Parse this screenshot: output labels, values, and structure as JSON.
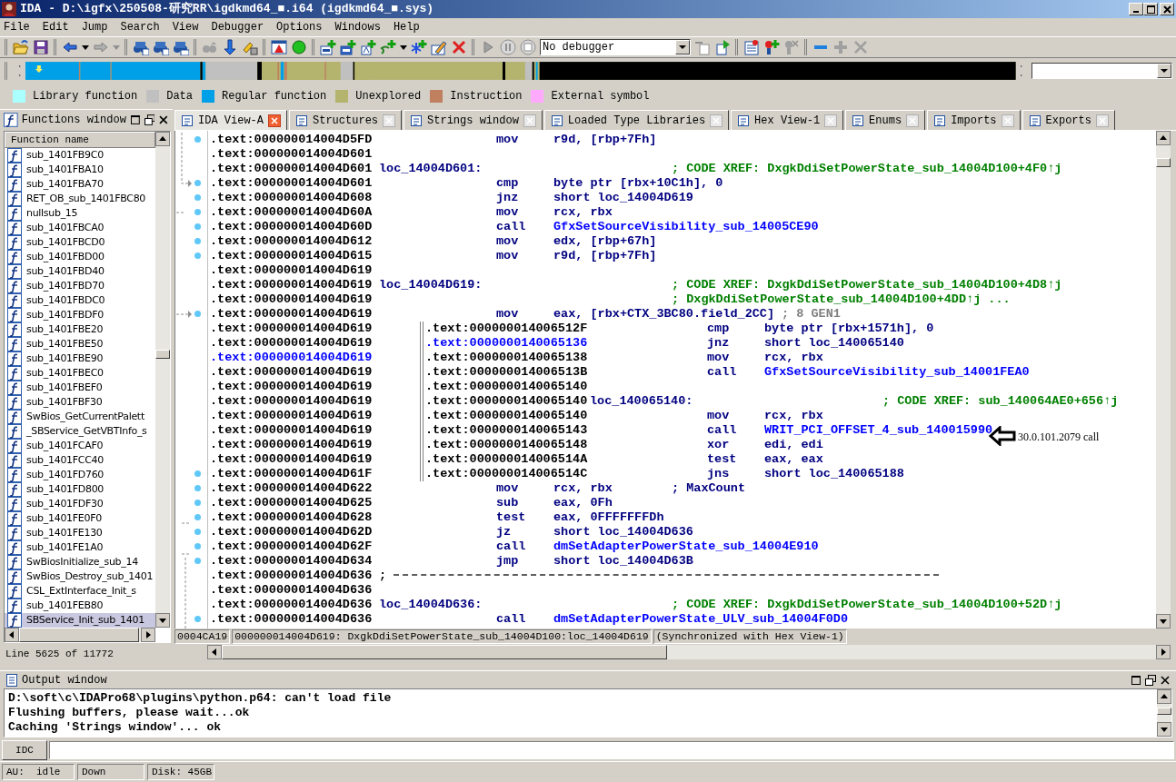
{
  "window": {
    "title": "IDA - D:\\igfx\\250508-研究RR\\igdkmd64_■.i64 (igdkmd64_■.sys)"
  },
  "menu": [
    "File",
    "Edit",
    "Jump",
    "Search",
    "View",
    "Debugger",
    "Options",
    "Windows",
    "Help"
  ],
  "toolbar": {
    "debugger": "No debugger"
  },
  "legend": [
    {
      "label": "Library function",
      "color": "#aaffff"
    },
    {
      "label": "Data",
      "color": "#c0c0c0"
    },
    {
      "label": "Regular function",
      "color": "#00a0e8"
    },
    {
      "label": "Unexplored",
      "color": "#b4b46e"
    },
    {
      "label": "Instruction",
      "color": "#c08060"
    },
    {
      "label": "External symbol",
      "color": "#ffaaff"
    }
  ],
  "functions_window": {
    "title": "Functions window",
    "column": "Function name",
    "line_info": "Line 5625 of 11772",
    "items": [
      {
        "name": "sub_1401FB9C0",
        "selected": false
      },
      {
        "name": "sub_1401FBA10",
        "selected": false
      },
      {
        "name": "sub_1401FBA70",
        "selected": false
      },
      {
        "name": "RET_OB_sub_1401FBC80",
        "selected": false
      },
      {
        "name": "nullsub_15",
        "selected": false
      },
      {
        "name": "sub_1401FBCA0",
        "selected": false
      },
      {
        "name": "sub_1401FBCD0",
        "selected": false
      },
      {
        "name": "sub_1401FBD00",
        "selected": false
      },
      {
        "name": "sub_1401FBD40",
        "selected": false
      },
      {
        "name": "sub_1401FBD70",
        "selected": false
      },
      {
        "name": "sub_1401FBDC0",
        "selected": false
      },
      {
        "name": "sub_1401FBDF0",
        "selected": false
      },
      {
        "name": "sub_1401FBE20",
        "selected": false
      },
      {
        "name": "sub_1401FBE50",
        "selected": false
      },
      {
        "name": "sub_1401FBE90",
        "selected": false
      },
      {
        "name": "sub_1401FBEC0",
        "selected": false
      },
      {
        "name": "sub_1401FBEF0",
        "selected": false
      },
      {
        "name": "sub_1401FBF30",
        "selected": false
      },
      {
        "name": "SwBios_GetCurrentPalett",
        "selected": false
      },
      {
        "name": "_SBService_GetVBTInfo_s",
        "selected": false
      },
      {
        "name": "sub_1401FCAF0",
        "selected": false
      },
      {
        "name": "sub_1401FCC40",
        "selected": false
      },
      {
        "name": "sub_1401FD760",
        "selected": false
      },
      {
        "name": "sub_1401FD800",
        "selected": false
      },
      {
        "name": "sub_1401FDF30",
        "selected": false
      },
      {
        "name": "sub_1401FE0F0",
        "selected": false
      },
      {
        "name": "sub_1401FE130",
        "selected": false
      },
      {
        "name": "sub_1401FE1A0",
        "selected": false
      },
      {
        "name": "SwBiosInitialize_sub_14",
        "selected": false
      },
      {
        "name": "SwBios_Destroy_sub_1401",
        "selected": false
      },
      {
        "name": "CSL_ExtInterface_Init_s",
        "selected": false
      },
      {
        "name": "sub_1401FEB80",
        "selected": false
      },
      {
        "name": "SBService_Init_sub_1401",
        "selected": true
      }
    ]
  },
  "tabs": [
    {
      "label": "IDA View-A",
      "selected": true
    },
    {
      "label": "Structures",
      "selected": false
    },
    {
      "label": "Strings window",
      "selected": false
    },
    {
      "label": "Loaded Type Libraries",
      "selected": false
    },
    {
      "label": "Hex View-1",
      "selected": false
    },
    {
      "label": "Enums",
      "selected": false
    },
    {
      "label": "Imports",
      "selected": false
    },
    {
      "label": "Exports",
      "selected": false
    }
  ],
  "listing": [
    {
      "address": ".text:000000014004D5FD",
      "current": false,
      "dot": true,
      "mnemonic": "mov",
      "operand": "r9d, [rbp+7Fh]",
      "link": false
    },
    {
      "address": ".text:000000014004D601",
      "current": false,
      "dot": false
    },
    {
      "address": ".text:000000014004D601",
      "current": false,
      "dot": false,
      "label": "loc_14004D601:",
      "comment": "; CODE XREF: DxgkDdiSetPowerState_sub_14004D100+4F0↑j"
    },
    {
      "address": ".text:000000014004D601",
      "current": false,
      "dot": true,
      "mnemonic": "cmp",
      "operand": "byte ptr [rbx+10C1h], 0",
      "link": false
    },
    {
      "address": ".text:000000014004D608",
      "current": false,
      "dot": true,
      "mnemonic": "jnz",
      "operand": "short loc_14004D619",
      "link": false
    },
    {
      "address": ".text:000000014004D60A",
      "current": false,
      "dot": true,
      "mnemonic": "mov",
      "operand": "rcx, rbx",
      "link": false
    },
    {
      "address": ".text:000000014004D60D",
      "current": false,
      "dot": true,
      "mnemonic": "call",
      "operand": "GfxSetSourceVisibility_sub_14005CE90",
      "link": true
    },
    {
      "address": ".text:000000014004D612",
      "current": false,
      "dot": true,
      "mnemonic": "mov",
      "operand": "edx, [rbp+67h]",
      "link": false
    },
    {
      "address": ".text:000000014004D615",
      "current": false,
      "dot": true,
      "mnemonic": "mov",
      "operand": "r9d, [rbp+7Fh]",
      "link": false
    },
    {
      "address": ".text:000000014004D619",
      "current": false,
      "dot": false
    },
    {
      "address": ".text:000000014004D619",
      "current": false,
      "dot": false,
      "label": "loc_14004D619:",
      "comment": "; CODE XREF: DxgkDdiSetPowerState_sub_14004D100+4D8↑j"
    },
    {
      "address": ".text:000000014004D619",
      "current": false,
      "dot": false,
      "comment": "; DxgkDdiSetPowerState_sub_14004D100+4DD↑j ..."
    },
    {
      "address": ".text:000000014004D619",
      "current": false,
      "dot": true,
      "mnemonic": "mov",
      "operand": "eax, [rbx+CTX_3BC80.field_2CC]",
      "link": false,
      "comment": "; 8 GEN1",
      "comment_faint": true
    },
    {
      "address": ".text:000000014004D619",
      "current": false,
      "dot": false
    },
    {
      "address": ".text:000000014004D619",
      "current": false,
      "dot": false
    },
    {
      "address": ".text:000000014004D619",
      "current": true,
      "dot": false
    },
    {
      "address": ".text:000000014004D619",
      "current": false,
      "dot": false
    },
    {
      "address": ".text:000000014004D619",
      "current": false,
      "dot": false
    },
    {
      "address": ".text:000000014004D619",
      "current": false,
      "dot": false
    },
    {
      "address": ".text:000000014004D619",
      "current": false,
      "dot": false
    },
    {
      "address": ".text:000000014004D619",
      "current": false,
      "dot": false
    },
    {
      "address": ".text:000000014004D619",
      "current": false,
      "dot": false
    },
    {
      "address": ".text:000000014004D619",
      "current": false,
      "dot": false
    },
    {
      "address": ".text:000000014004D61F",
      "current": false,
      "dot": true
    },
    {
      "address": ".text:000000014004D622",
      "current": false,
      "dot": true,
      "mnemonic": "mov",
      "operand": "rcx, rbx",
      "link": false,
      "comment": "; MaxCount",
      "comment_faint": false
    },
    {
      "address": ".text:000000014004D625",
      "current": false,
      "dot": true,
      "mnemonic": "sub",
      "operand": "eax, 0Fh",
      "link": false
    },
    {
      "address": ".text:000000014004D628",
      "current": false,
      "dot": true,
      "mnemonic": "test",
      "operand": "eax, 0FFFFFFFDh",
      "link": false
    },
    {
      "address": ".text:000000014004D62D",
      "current": false,
      "dot": true,
      "mnemonic": "jz",
      "operand": "short loc_14004D636",
      "link": false
    },
    {
      "address": ".text:000000014004D62F",
      "current": false,
      "dot": true,
      "mnemonic": "call",
      "operand": "dmSetAdapterPowerState_sub_14004E910",
      "link": true
    },
    {
      "address": ".text:000000014004D634",
      "current": false,
      "dot": true,
      "mnemonic": "jmp",
      "operand": "short loc_14004D63B",
      "link": false
    },
    {
      "address": ".text:000000014004D636",
      "current": false,
      "dot": false,
      "kind": "separator",
      "label": ";"
    },
    {
      "address": ".text:000000014004D636",
      "current": false,
      "dot": false
    },
    {
      "address": ".text:000000014004D636",
      "current": false,
      "dot": false,
      "label": "loc_14004D636:",
      "comment": "; CODE XREF: DxgkDdiSetPowerState_sub_14004D100+52D↑j"
    },
    {
      "address": ".text:000000014004D636",
      "current": false,
      "dot": true,
      "mnemonic": "call",
      "operand": "dmSetAdapterPowerState_ULV_sub_14004F0D0",
      "link": true
    }
  ],
  "popup": [
    {
      "address": ".text:000000014006512F",
      "current": false,
      "mnemonic": "cmp",
      "operand": "byte ptr [rbx+1571h], 0",
      "link": false
    },
    {
      "address": ".text:0000000140065136",
      "current": true,
      "mnemonic": "jnz",
      "operand": "short loc_140065140",
      "link": false
    },
    {
      "address": ".text:0000000140065138",
      "current": false,
      "mnemonic": "mov",
      "operand": "rcx, rbx",
      "link": false
    },
    {
      "address": ".text:000000014006513B",
      "current": false,
      "mnemonic": "call",
      "operand": "GfxSetSourceVisibility_sub_14001FEA0",
      "link": true
    },
    {
      "address": ".text:0000000140065140",
      "current": false
    },
    {
      "address": ".text:0000000140065140",
      "current": false,
      "label": "loc_140065140:",
      "comment": "; CODE XREF: sub_140064AE0+656↑j"
    },
    {
      "address": ".text:0000000140065140",
      "current": false,
      "mnemonic": "mov",
      "operand": "rcx, rbx",
      "link": false
    },
    {
      "address": ".text:0000000140065143",
      "current": false,
      "mnemonic": "call",
      "operand": "WRIT_PCI_OFFSET_4_sub_140015990",
      "link": true
    },
    {
      "address": ".text:0000000140065148",
      "current": false,
      "mnemonic": "xor",
      "operand": "edi, edi",
      "link": false
    },
    {
      "address": ".text:000000014006514A",
      "current": false,
      "mnemonic": "test",
      "operand": "eax, eax",
      "link": false
    },
    {
      "address": ".text:000000014006514C",
      "current": false,
      "mnemonic": "jns",
      "operand": "short loc_140065188",
      "link": false
    }
  ],
  "annotation": "30.0.101.2079 call",
  "listing_status": [
    "0004CA19",
    "000000014004D619: DxgkDdiSetPowerState_sub_14004D100:loc_14004D619",
    "(Synchronized with Hex View-1)"
  ],
  "output_window": {
    "title": "Output window",
    "lines": [
      "D:\\soft\\c\\IDAPro68\\plugins\\python.p64: can't load file",
      "Flushing buffers, please wait...ok",
      "Caching 'Strings window'... ok"
    ]
  },
  "command": {
    "button": "IDC"
  },
  "status_bar": [
    "AU:  idle",
    "Down",
    "Disk: 45GB"
  ]
}
